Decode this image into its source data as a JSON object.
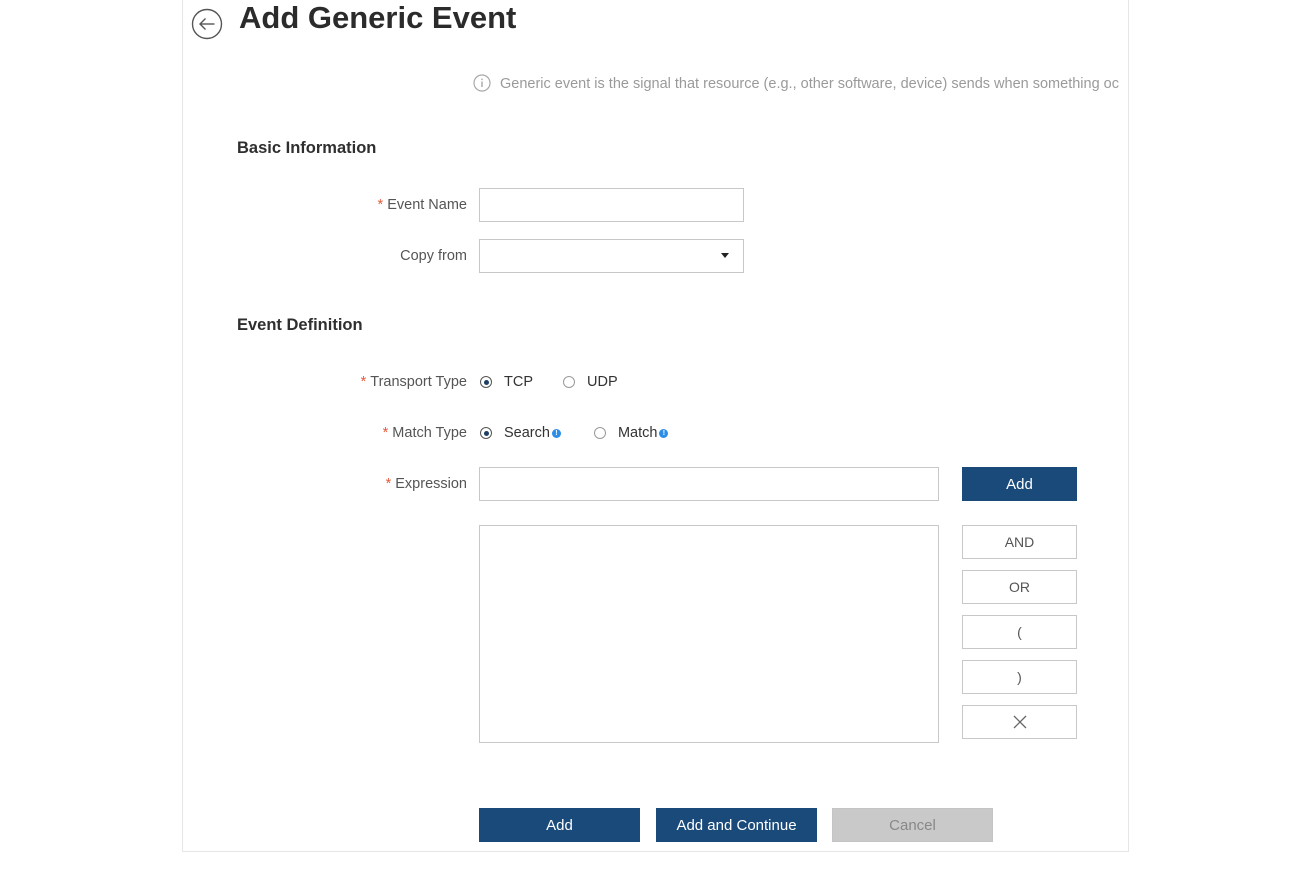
{
  "header": {
    "title": "Add Generic Event",
    "info_text": "Generic event is the signal that resource (e.g., other software, device) sends when something oc"
  },
  "basic_information": {
    "section_title": "Basic Information",
    "event_name": {
      "required_mark": "*",
      "label": "Event Name",
      "value": ""
    },
    "copy_from": {
      "label": "Copy from",
      "value": ""
    }
  },
  "event_definition": {
    "section_title": "Event Definition",
    "transport_type": {
      "required_mark": "*",
      "label": "Transport Type",
      "options": [
        "TCP",
        "UDP"
      ],
      "selected": "TCP"
    },
    "match_type": {
      "required_mark": "*",
      "label": "Match Type",
      "options": [
        "Search",
        "Match"
      ],
      "selected": "Search"
    },
    "expression": {
      "required_mark": "*",
      "label": "Expression",
      "value": "",
      "add_label": "Add",
      "expression_list_value": ""
    },
    "operators": {
      "and": "AND",
      "or": "OR",
      "open_paren": "(",
      "close_paren": ")"
    }
  },
  "footer": {
    "add_label": "Add",
    "add_continue_label": "Add and Continue",
    "cancel_label": "Cancel"
  },
  "colors": {
    "primary": "#1a4a7a",
    "required": "#e8593a",
    "help_icon": "#2d8ee8",
    "disabled_button": "#c9c9c9"
  }
}
